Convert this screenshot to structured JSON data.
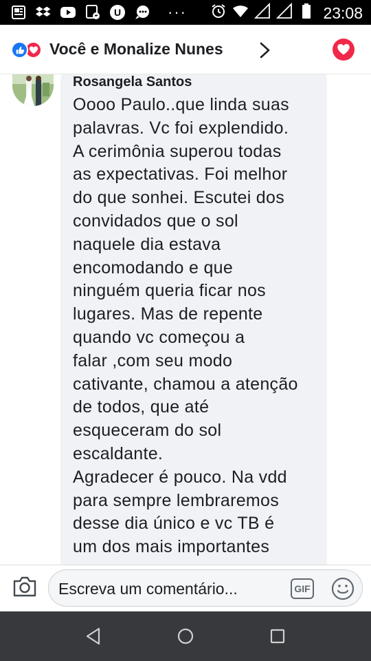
{
  "status_bar": {
    "time": "23:08",
    "more_indicator": "···",
    "left_icons": [
      "news-icon",
      "dropbox-icon",
      "youtube-icon",
      "messenger-icon",
      "u-app-icon",
      "chat-icon"
    ],
    "right_icons": [
      "alarm-icon",
      "wifi-icon",
      "signal-icon",
      "signal-icon",
      "battery-icon"
    ]
  },
  "header": {
    "title": "Você e Monalize Nunes",
    "reactions": [
      "like",
      "love"
    ],
    "colors": {
      "like": "#1877f2",
      "love": "#f0284a"
    }
  },
  "comment": {
    "author": "Rosangela Santos",
    "lines": [
      "Oooo Paulo..que linda suas",
      "palavras. Vc foi explendido.",
      "A cerimônia superou todas",
      "as expectativas. Foi melhor",
      "do que sonhei. Escutei dos",
      "convidados que o sol",
      "naquele dia estava",
      "encomodando e que",
      "ninguém queria ficar nos",
      "lugares. Mas de repente",
      "quando vc começou a",
      "falar ,com seu modo",
      "cativante, chamou a atenção",
      "de todos, que até",
      "esqueceram do sol",
      "escaldante.",
      "Agradecer é pouco. Na vdd",
      "para sempre lembraremos",
      "desse dia único e vc TB é",
      "um dos mais importantes"
    ]
  },
  "composer": {
    "placeholder": "Escreva um comentário...",
    "gif_label": "GIF"
  },
  "colors": {
    "bubble": "#f0f2f5",
    "nav_bar": "#37393d"
  }
}
